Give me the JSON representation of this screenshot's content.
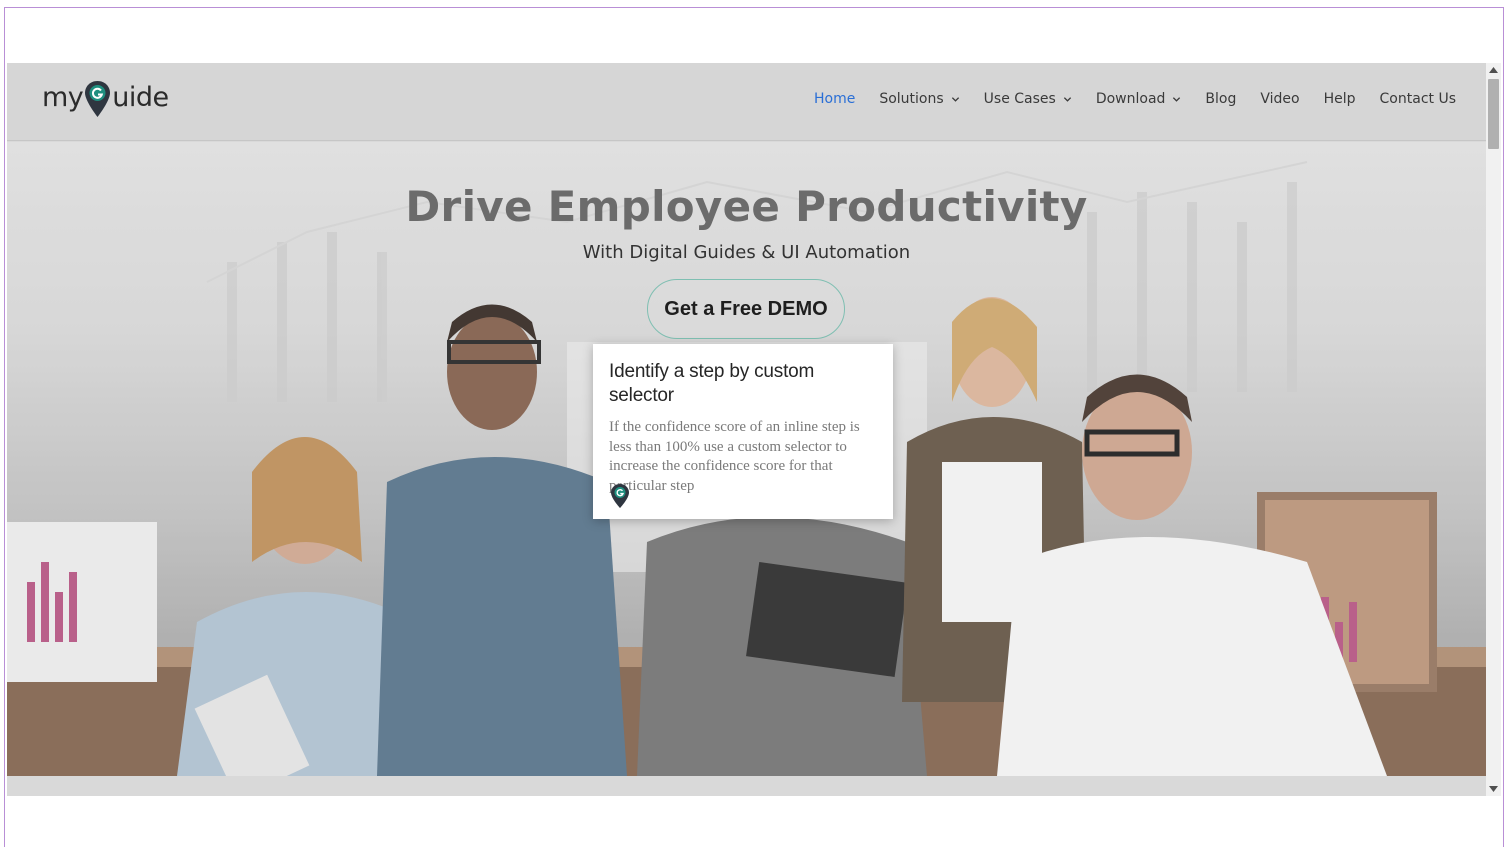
{
  "header": {
    "logo_left": "my",
    "logo_right": "uide",
    "nav": [
      {
        "label": "Home",
        "active": true,
        "dropdown": false
      },
      {
        "label": "Solutions",
        "active": false,
        "dropdown": true
      },
      {
        "label": "Use Cases",
        "active": false,
        "dropdown": true
      },
      {
        "label": "Download",
        "active": false,
        "dropdown": true
      },
      {
        "label": "Blog",
        "active": false,
        "dropdown": false
      },
      {
        "label": "Video",
        "active": false,
        "dropdown": false
      },
      {
        "label": "Help",
        "active": false,
        "dropdown": false
      },
      {
        "label": "Contact Us",
        "active": false,
        "dropdown": false
      }
    ]
  },
  "hero": {
    "title": "Drive Employee Productivity",
    "subtitle": "With Digital Guides & UI Automation",
    "cta_label": "Get a Free DEMO"
  },
  "tooltip": {
    "title": "Identify a step by custom selector",
    "body": "If the confidence score of an inline step is less than 100% use a custom selector to increase the confidence score for that particular step"
  },
  "colors": {
    "accent": "#2a6fd6",
    "brand_teal": "#1f8f7f",
    "frame": "#b98fd6"
  },
  "icons": {
    "logo_pin": "map-pin-g-icon",
    "chevron": "chevron-down-icon",
    "tooltip_brand": "myguide-pin-icon"
  }
}
